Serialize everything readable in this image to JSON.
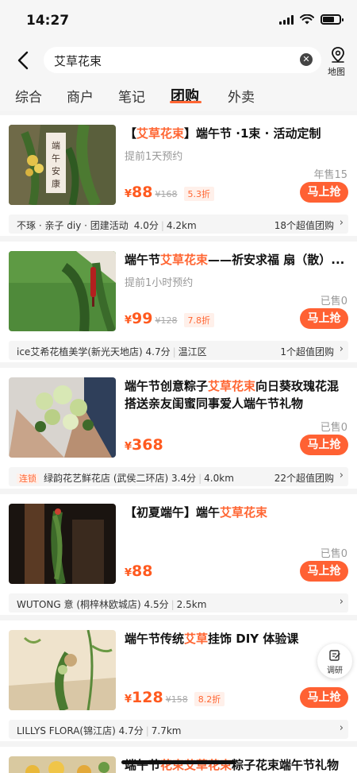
{
  "status_bar": {
    "time": "14:27"
  },
  "header": {
    "search_value": "艾草花束",
    "map_label": "地图"
  },
  "tabs": [
    {
      "label": "综合",
      "active": false
    },
    {
      "label": "商户",
      "active": false
    },
    {
      "label": "笔记",
      "active": false
    },
    {
      "label": "团购",
      "active": true
    },
    {
      "label": "外卖",
      "active": false
    }
  ],
  "items": [
    {
      "title_pre": "【",
      "title_hl": "艾草花束",
      "title_post": "】端午节 ·1束 · 活动定制",
      "note": "提前1天预约",
      "sold": "年售15",
      "price_sym": "¥",
      "price": "88",
      "orig": "¥168",
      "disc": "5.3折",
      "buy": "马上抢",
      "shop": "不琢 · 亲子 diy · 团建活动",
      "rating": "4.0分",
      "dist": "4.2km",
      "chain": "",
      "deals": "18个超值团购"
    },
    {
      "title_pre": "端午节",
      "title_hl": "艾草花束",
      "title_post": "——祈安求福 扇（散）...",
      "note": "提前1小时预约",
      "sold": "已售0",
      "price_sym": "¥",
      "price": "99",
      "orig": "¥128",
      "disc": "7.8折",
      "buy": "马上抢",
      "shop": "ice艾希花植美学(新光天地店)",
      "rating": "4.7分",
      "dist": "温江区",
      "chain": "",
      "deals": "1个超值团购"
    },
    {
      "title_pre": "端午节创意粽子",
      "title_hl": "艾草花束",
      "title_post": "向日葵玫瑰花混搭送亲友闺蜜同事爱人端午节礼物",
      "note": "",
      "sold": "已售0",
      "price_sym": "¥",
      "price": "368",
      "orig": "",
      "disc": "",
      "buy": "马上抢",
      "shop": "绿韵花艺鲜花店 (武侯二环店)",
      "rating": "3.4分",
      "dist": "4.0km",
      "chain": "连锁",
      "deals": "22个超值团购"
    },
    {
      "title_pre": "【初夏端午】端午",
      "title_hl": "艾草花束",
      "title_post": "",
      "note": "",
      "sold": "已售0",
      "price_sym": "¥",
      "price": "88",
      "orig": "",
      "disc": "",
      "buy": "马上抢",
      "shop": "WUTONG 意 (桐梓林欧城店)",
      "rating": "4.5分",
      "dist": "2.5km",
      "chain": "",
      "deals": ""
    },
    {
      "title_pre": "端午节传统",
      "title_hl": "艾草",
      "title_post": "挂饰 DIY 体验课",
      "note": "",
      "sold": "",
      "price_sym": "¥",
      "price": "128",
      "orig": "¥158",
      "disc": "8.2折",
      "buy": "马上抢",
      "shop": "LILLYS FLORA(锦江店)",
      "rating": "4.7分",
      "dist": "7.7km",
      "chain": "",
      "deals": ""
    },
    {
      "title_pre": "端午节",
      "title_hl": "花束艾草花束",
      "title_post": "粽子花束端午节礼物",
      "note": "",
      "sold": "",
      "price_sym": "",
      "price": "",
      "orig": "",
      "disc": "",
      "buy": "",
      "shop": "",
      "rating": "",
      "dist": "",
      "chain": "",
      "deals": ""
    }
  ],
  "survey": {
    "label": "调研"
  },
  "colors": {
    "accent": "#ff6633",
    "buy_button": "#ff6133",
    "background": "#f4f4f4"
  }
}
